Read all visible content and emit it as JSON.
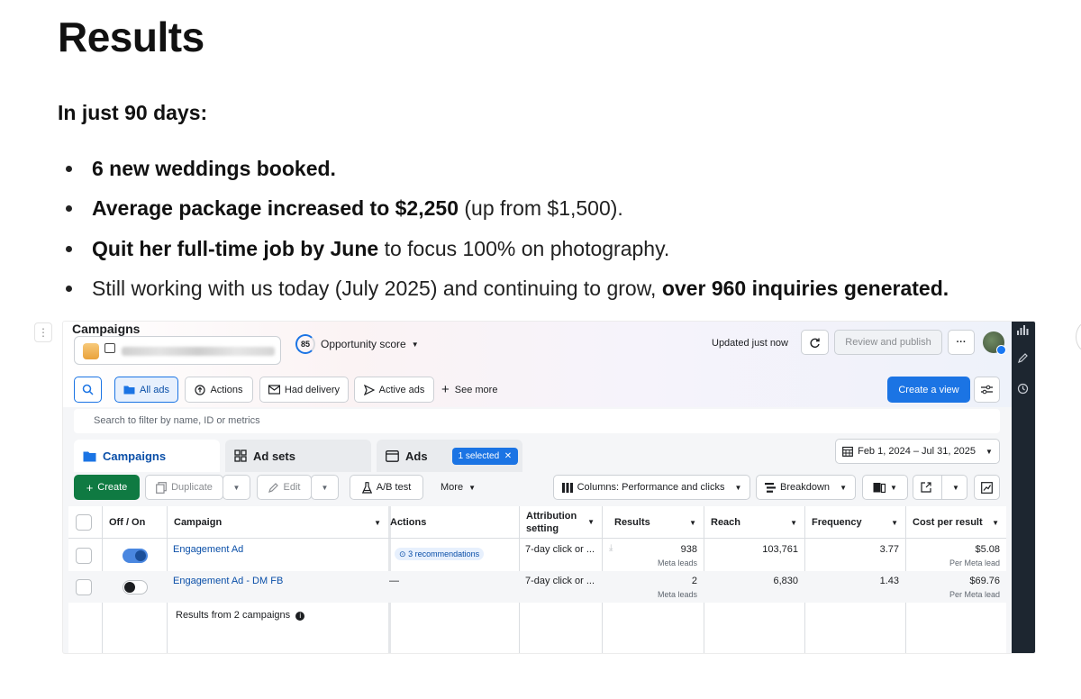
{
  "doc": {
    "title": "Results",
    "subtitle": "In just 90 days:",
    "bullets": [
      {
        "bold": "6 new weddings booked.",
        "rest": "",
        "bold2": ""
      },
      {
        "bold": "Average package increased to $2,250",
        "rest": " (up from $1,500).",
        "bold2": ""
      },
      {
        "bold": "Quit her full-time job by June",
        "rest": " to focus 100% on photography.",
        "bold2": ""
      },
      {
        "bold": "",
        "rest": "Still working with us today (July 2025) and continuing to grow, ",
        "bold2": "over 960 inquiries generated."
      }
    ]
  },
  "ads_manager": {
    "page_title": "Campaigns",
    "opportunity_score": "85",
    "opportunity_label": "Opportunity score",
    "updated": "Updated just now",
    "review_publish": "Review and publish",
    "more_dots": "···",
    "filters": {
      "all_ads": "All ads",
      "actions": "Actions",
      "had_delivery": "Had delivery",
      "active_ads": "Active ads",
      "see_more": "See more",
      "create_view": "Create a view"
    },
    "search_placeholder": "Search to filter by name, ID or metrics",
    "tabs": {
      "campaigns": "Campaigns",
      "ad_sets": "Ad sets",
      "ads": "Ads",
      "selected": "1 selected"
    },
    "date_range": "Feb 1, 2024 – Jul 31, 2025",
    "toolbar": {
      "create": "Create",
      "duplicate": "Duplicate",
      "edit": "Edit",
      "ab_test": "A/B test",
      "more": "More",
      "columns": "Columns: Performance and clicks",
      "breakdown": "Breakdown"
    },
    "columns": [
      "Off / On",
      "Campaign",
      "Actions",
      "Attribution setting",
      "Results",
      "Reach",
      "Frequency",
      "Cost per result"
    ],
    "rows": [
      {
        "on": true,
        "campaign": "Engagement Ad",
        "actions": "3 recommendations",
        "attribution": "7-day click or ...",
        "results": "938",
        "results_sub": "Meta leads",
        "reach": "103,761",
        "frequency": "3.77",
        "cost": "$5.08",
        "cost_sub": "Per Meta lead"
      },
      {
        "on": false,
        "campaign": "Engagement Ad - DM FB",
        "actions": "—",
        "attribution": "7-day click or ...",
        "results": "2",
        "results_sub": "Meta leads",
        "reach": "6,830",
        "frequency": "1.43",
        "cost": "$69.76",
        "cost_sub": "Per Meta lead"
      }
    ],
    "footer": "Results from 2 campaigns"
  },
  "colors": {
    "accent_blue": "#1b74e4",
    "create_green": "#0f7a42",
    "rail_dark": "#1d2630"
  }
}
